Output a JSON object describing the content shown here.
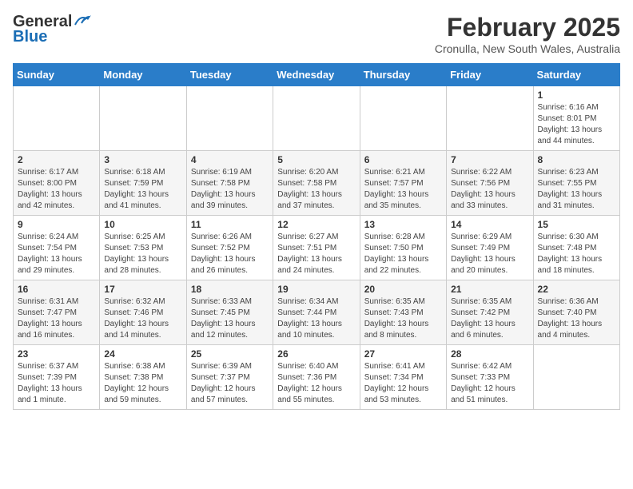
{
  "header": {
    "logo_line1": "General",
    "logo_line2": "Blue",
    "title": "February 2025",
    "subtitle": "Cronulla, New South Wales, Australia"
  },
  "weekdays": [
    "Sunday",
    "Monday",
    "Tuesday",
    "Wednesday",
    "Thursday",
    "Friday",
    "Saturday"
  ],
  "weeks": [
    [
      {
        "day": "",
        "info": ""
      },
      {
        "day": "",
        "info": ""
      },
      {
        "day": "",
        "info": ""
      },
      {
        "day": "",
        "info": ""
      },
      {
        "day": "",
        "info": ""
      },
      {
        "day": "",
        "info": ""
      },
      {
        "day": "1",
        "info": "Sunrise: 6:16 AM\nSunset: 8:01 PM\nDaylight: 13 hours\nand 44 minutes."
      }
    ],
    [
      {
        "day": "2",
        "info": "Sunrise: 6:17 AM\nSunset: 8:00 PM\nDaylight: 13 hours\nand 42 minutes."
      },
      {
        "day": "3",
        "info": "Sunrise: 6:18 AM\nSunset: 7:59 PM\nDaylight: 13 hours\nand 41 minutes."
      },
      {
        "day": "4",
        "info": "Sunrise: 6:19 AM\nSunset: 7:58 PM\nDaylight: 13 hours\nand 39 minutes."
      },
      {
        "day": "5",
        "info": "Sunrise: 6:20 AM\nSunset: 7:58 PM\nDaylight: 13 hours\nand 37 minutes."
      },
      {
        "day": "6",
        "info": "Sunrise: 6:21 AM\nSunset: 7:57 PM\nDaylight: 13 hours\nand 35 minutes."
      },
      {
        "day": "7",
        "info": "Sunrise: 6:22 AM\nSunset: 7:56 PM\nDaylight: 13 hours\nand 33 minutes."
      },
      {
        "day": "8",
        "info": "Sunrise: 6:23 AM\nSunset: 7:55 PM\nDaylight: 13 hours\nand 31 minutes."
      }
    ],
    [
      {
        "day": "9",
        "info": "Sunrise: 6:24 AM\nSunset: 7:54 PM\nDaylight: 13 hours\nand 29 minutes."
      },
      {
        "day": "10",
        "info": "Sunrise: 6:25 AM\nSunset: 7:53 PM\nDaylight: 13 hours\nand 28 minutes."
      },
      {
        "day": "11",
        "info": "Sunrise: 6:26 AM\nSunset: 7:52 PM\nDaylight: 13 hours\nand 26 minutes."
      },
      {
        "day": "12",
        "info": "Sunrise: 6:27 AM\nSunset: 7:51 PM\nDaylight: 13 hours\nand 24 minutes."
      },
      {
        "day": "13",
        "info": "Sunrise: 6:28 AM\nSunset: 7:50 PM\nDaylight: 13 hours\nand 22 minutes."
      },
      {
        "day": "14",
        "info": "Sunrise: 6:29 AM\nSunset: 7:49 PM\nDaylight: 13 hours\nand 20 minutes."
      },
      {
        "day": "15",
        "info": "Sunrise: 6:30 AM\nSunset: 7:48 PM\nDaylight: 13 hours\nand 18 minutes."
      }
    ],
    [
      {
        "day": "16",
        "info": "Sunrise: 6:31 AM\nSunset: 7:47 PM\nDaylight: 13 hours\nand 16 minutes."
      },
      {
        "day": "17",
        "info": "Sunrise: 6:32 AM\nSunset: 7:46 PM\nDaylight: 13 hours\nand 14 minutes."
      },
      {
        "day": "18",
        "info": "Sunrise: 6:33 AM\nSunset: 7:45 PM\nDaylight: 13 hours\nand 12 minutes."
      },
      {
        "day": "19",
        "info": "Sunrise: 6:34 AM\nSunset: 7:44 PM\nDaylight: 13 hours\nand 10 minutes."
      },
      {
        "day": "20",
        "info": "Sunrise: 6:35 AM\nSunset: 7:43 PM\nDaylight: 13 hours\nand 8 minutes."
      },
      {
        "day": "21",
        "info": "Sunrise: 6:35 AM\nSunset: 7:42 PM\nDaylight: 13 hours\nand 6 minutes."
      },
      {
        "day": "22",
        "info": "Sunrise: 6:36 AM\nSunset: 7:40 PM\nDaylight: 13 hours\nand 4 minutes."
      }
    ],
    [
      {
        "day": "23",
        "info": "Sunrise: 6:37 AM\nSunset: 7:39 PM\nDaylight: 13 hours\nand 1 minute."
      },
      {
        "day": "24",
        "info": "Sunrise: 6:38 AM\nSunset: 7:38 PM\nDaylight: 12 hours\nand 59 minutes."
      },
      {
        "day": "25",
        "info": "Sunrise: 6:39 AM\nSunset: 7:37 PM\nDaylight: 12 hours\nand 57 minutes."
      },
      {
        "day": "26",
        "info": "Sunrise: 6:40 AM\nSunset: 7:36 PM\nDaylight: 12 hours\nand 55 minutes."
      },
      {
        "day": "27",
        "info": "Sunrise: 6:41 AM\nSunset: 7:34 PM\nDaylight: 12 hours\nand 53 minutes."
      },
      {
        "day": "28",
        "info": "Sunrise: 6:42 AM\nSunset: 7:33 PM\nDaylight: 12 hours\nand 51 minutes."
      },
      {
        "day": "",
        "info": ""
      }
    ]
  ]
}
